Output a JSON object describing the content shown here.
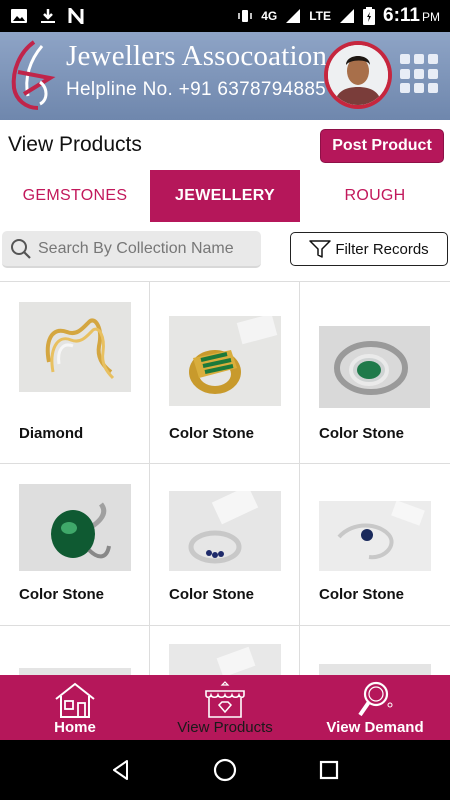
{
  "status": {
    "network": "4G",
    "lte": "LTE",
    "time": "6:11",
    "ampm": "PM"
  },
  "header": {
    "title": "Jewellers Assocoation",
    "helpline": "Helpline No. +91 6378794885"
  },
  "page": {
    "title": "View Products",
    "post_label": "Post Product"
  },
  "tabs": [
    {
      "label": "GEMSTONES",
      "active": false
    },
    {
      "label": "JEWELLERY",
      "active": true
    },
    {
      "label": "ROUGH",
      "active": false
    }
  ],
  "search": {
    "placeholder": "Search By Collection Name",
    "value": ""
  },
  "filter": {
    "label": "Filter Records"
  },
  "products": [
    {
      "name": "Diamond",
      "icon": "gold-diamond-bangle"
    },
    {
      "name": "Color Stone",
      "icon": "gold-emerald-ring"
    },
    {
      "name": "Color Stone",
      "icon": "emerald-halo-ring"
    },
    {
      "name": "Color Stone",
      "icon": "green-oval-ring"
    },
    {
      "name": "Color Stone",
      "icon": "sapphire-band-ring"
    },
    {
      "name": "Color Stone",
      "icon": "sapphire-bypass-ring"
    },
    {
      "name": "",
      "icon": "ring-partial"
    },
    {
      "name": "",
      "icon": "ring-partial"
    },
    {
      "name": "",
      "icon": "ring-partial"
    }
  ],
  "bottom_nav": [
    {
      "label": "Home",
      "icon": "home-icon",
      "active": false
    },
    {
      "label": "View Products",
      "icon": "store-icon",
      "active": true
    },
    {
      "label": "View Demand",
      "icon": "magnifier-icon",
      "active": false
    }
  ],
  "colors": {
    "brand": "#b5175a",
    "banner": "#7b92b8"
  }
}
